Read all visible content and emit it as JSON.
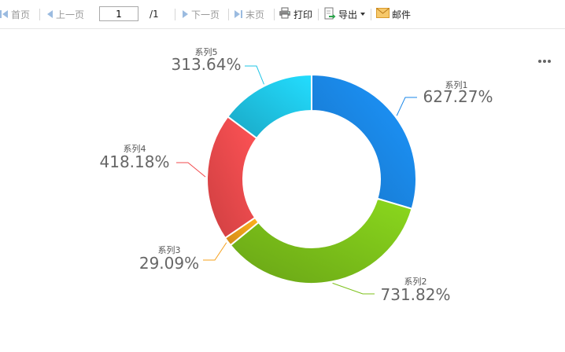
{
  "toolbar": {
    "first": "首页",
    "prev": "上一页",
    "page_value": "1",
    "page_total": "/1",
    "next": "下一页",
    "last": "末页",
    "print": "打印",
    "export": "导出",
    "mail": "邮件"
  },
  "colors": {
    "accent_disabled": "#9bbbe0",
    "series": [
      "#1a87e8",
      "#7cc11a",
      "#f7a01b",
      "#f24a4d",
      "#1fc5e6"
    ]
  },
  "chart_data": {
    "type": "pie",
    "variant": "donut",
    "title": "",
    "series": [
      {
        "name": "系列1",
        "value": 627.27,
        "label": "627.27%"
      },
      {
        "name": "系列2",
        "value": 731.82,
        "label": "731.82%"
      },
      {
        "name": "系列3",
        "value": 29.09,
        "label": "29.09%"
      },
      {
        "name": "系列4",
        "value": 418.18,
        "label": "418.18%"
      },
      {
        "name": "系列5",
        "value": 313.64,
        "label": "313.64%"
      }
    ]
  }
}
